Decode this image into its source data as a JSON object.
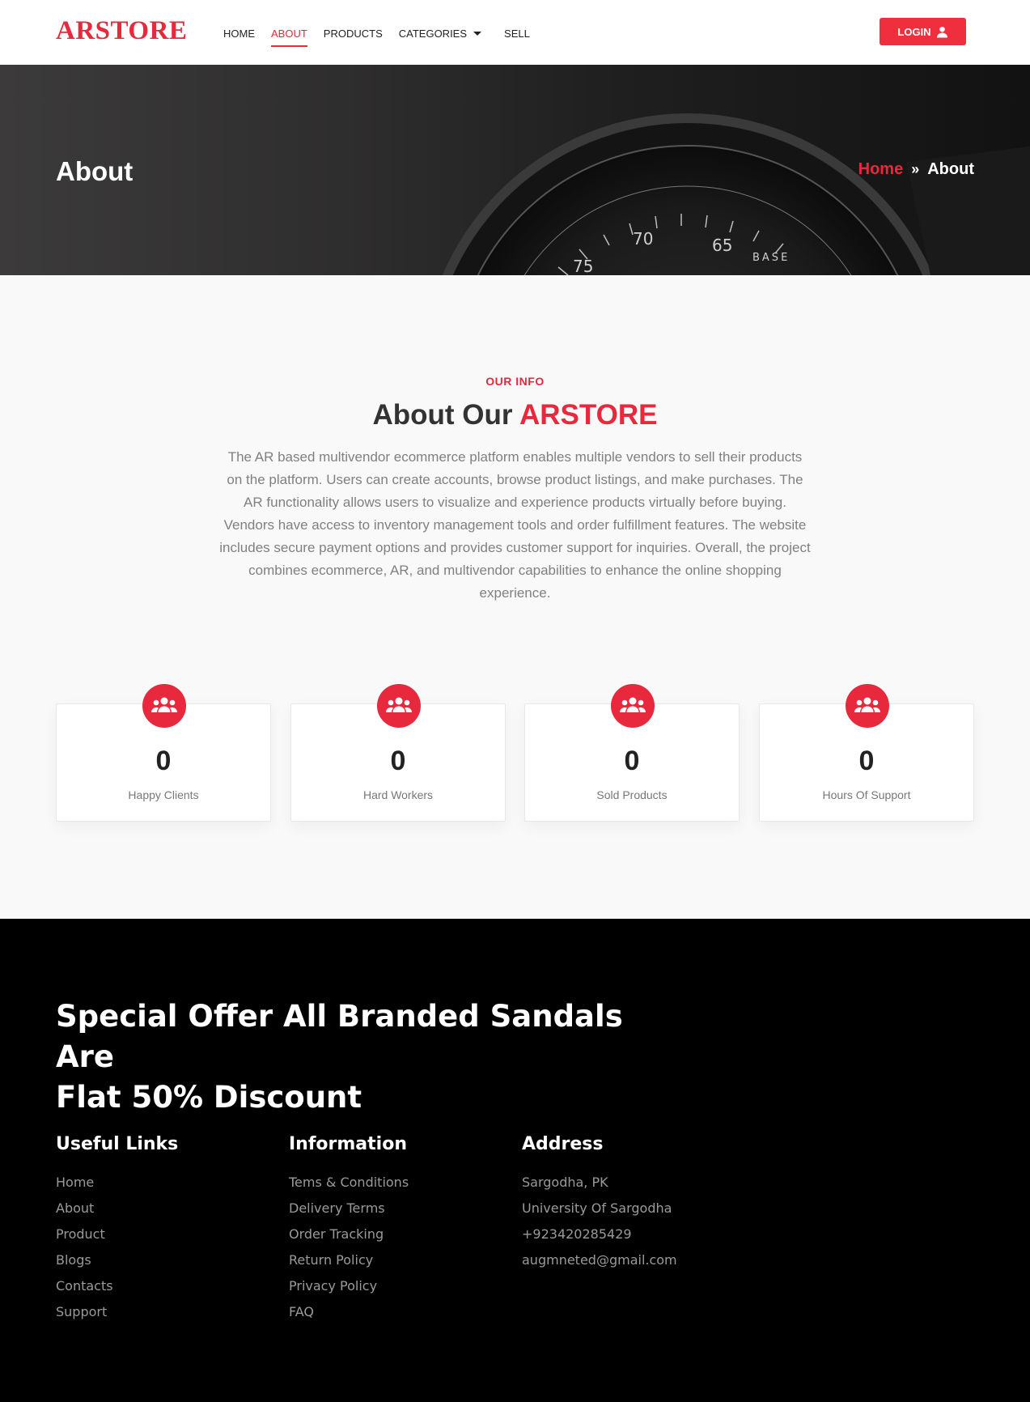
{
  "header": {
    "logo": "ARSTORE",
    "nav": {
      "home": "HOME",
      "about": "ABOUT",
      "products": "PRODUCTS",
      "categories": "CATEGORIES",
      "sell": "SELL"
    },
    "login_label": "LOGIN"
  },
  "hero": {
    "title": "About",
    "breadcrumb": {
      "home": "Home",
      "separator": "»",
      "current": "About"
    }
  },
  "about": {
    "kicker": "OUR INFO",
    "title_prefix": "About Our ",
    "title_accent": "ARSTORE",
    "description": "The AR based multivendor ecommerce platform enables multiple vendors to sell their products on the platform. Users can create accounts, browse product listings, and make purchases. The AR functionality allows users to visualize and experience products virtually before buying. Vendors have access to inventory management tools and order fulfillment features. The website includes secure payment options and provides customer support for inquiries. Overall, the project combines ecommerce, AR, and multivendor capabilities to enhance the online shopping experience."
  },
  "stats": [
    {
      "value": "0",
      "label": "Happy Clients",
      "icon": "users-icon"
    },
    {
      "value": "0",
      "label": "Hard Workers",
      "icon": "users-icon"
    },
    {
      "value": "0",
      "label": "Sold Products",
      "icon": "users-icon"
    },
    {
      "value": "0",
      "label": "Hours Of Support",
      "icon": "users-icon"
    }
  ],
  "footer": {
    "offer_line1": "Special Offer All Branded Sandals Are",
    "offer_line2": "Flat 50% Discount",
    "useful_links": {
      "title": "Useful Links",
      "items": [
        "Home",
        "About",
        "Product",
        "Blogs",
        "Contacts",
        "Support"
      ]
    },
    "information": {
      "title": "Information",
      "items": [
        "Tems & Conditions",
        "Delivery Terms",
        "Order Tracking",
        "Return Policy",
        "Privacy Policy",
        "FAQ"
      ]
    },
    "address": {
      "title": "Address",
      "items": [
        "Sargodha, PK",
        "University Of Sargodha",
        "+923420285429",
        "augmneted@gmail.com"
      ]
    }
  },
  "colors": {
    "accent": "#e8283c",
    "footer_bg": "#000000",
    "section_bg": "#f9f9f9"
  }
}
